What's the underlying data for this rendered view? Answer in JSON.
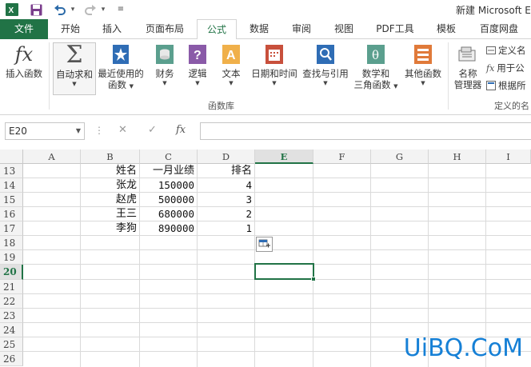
{
  "titlebar": {
    "title": "新建 Microsoft E",
    "icons": [
      "excel-logo-icon",
      "save-icon",
      "undo-icon",
      "redo-icon",
      "customize-qat-icon"
    ]
  },
  "tabs": {
    "file": "文件",
    "home": "开始",
    "insert": "插入",
    "page_layout": "页面布局",
    "formulas": "公式",
    "data": "数据",
    "review": "审阅",
    "view": "视图",
    "pdf": "PDF工具",
    "template": "模板",
    "baidu": "百度网盘"
  },
  "ribbon": {
    "insert_function": "插入函数",
    "autosum": "自动求和",
    "recent_1": "最近使用的",
    "recent_2": "函数",
    "financial": "财务",
    "logical": "逻辑",
    "text": "文本",
    "datetime": "日期和时间",
    "lookup": "查找与引用",
    "math_1": "数学和",
    "math_2": "三角函数",
    "more": "其他函数",
    "name_mgr_1": "名称",
    "name_mgr_2": "管理器",
    "define_name": "定义名",
    "use_in_formula": "用于公",
    "create_from_sel": "根据所",
    "group_function_library": "函数库",
    "group_defined_names": "定义的名"
  },
  "formula_bar": {
    "name_box": "E20",
    "dots": "⋮",
    "cancel": "✕",
    "enter": "✓",
    "fx": "fx",
    "value": ""
  },
  "grid": {
    "columns": [
      "A",
      "B",
      "C",
      "D",
      "E",
      "F",
      "G",
      "H",
      "I"
    ],
    "selected_column": "E",
    "rows": [
      "13",
      "14",
      "15",
      "16",
      "17",
      "18",
      "19",
      "20",
      "21",
      "22",
      "23",
      "24",
      "25",
      "26"
    ],
    "selected_row": "20",
    "header_row": {
      "name": "姓名",
      "sales": "一月业绩",
      "rank": "排名"
    },
    "data": [
      {
        "name": "张龙",
        "sales": "150000",
        "rank": "4"
      },
      {
        "name": "赵虎",
        "sales": "500000",
        "rank": "3"
      },
      {
        "name": "王三",
        "sales": "680000",
        "rank": "2"
      },
      {
        "name": "李狗",
        "sales": "890000",
        "rank": "1"
      }
    ],
    "selected_cell": "E20"
  },
  "watermark": "UiBQ.CoM"
}
